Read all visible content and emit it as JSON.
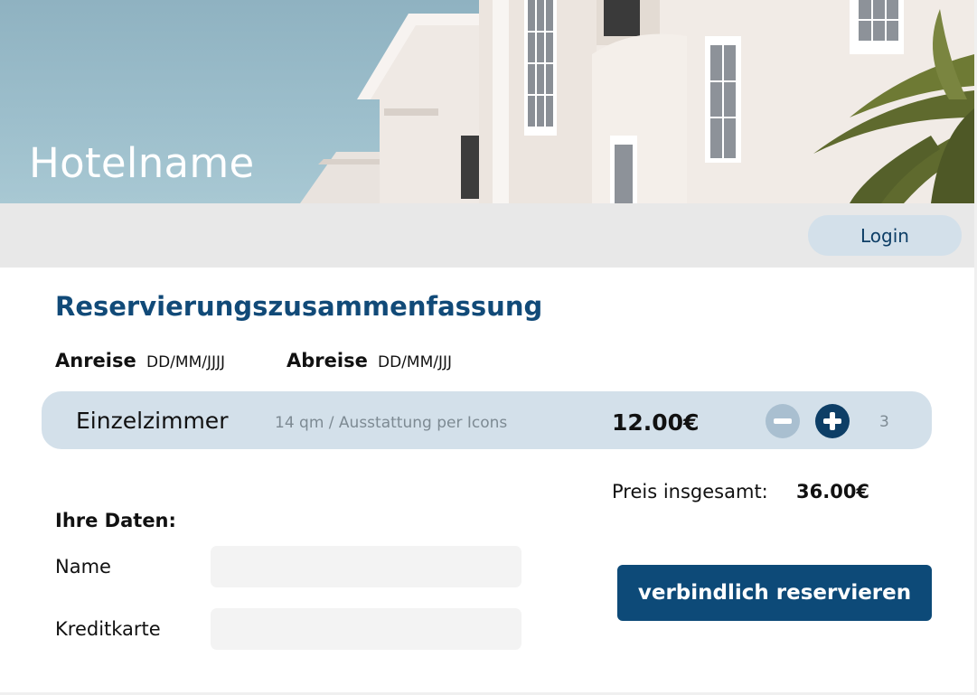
{
  "header": {
    "hotel_name": "Hotelname",
    "login_label": "Login"
  },
  "summary": {
    "title": "Reservierungszusammenfassung",
    "arrival_label": "Anreise",
    "arrival_value": "DD/MM/JJJJ",
    "departure_label": "Abreise",
    "departure_value": "DD/MM/JJJ"
  },
  "room": {
    "name": "Einzelzimmer",
    "description": "14 qm / Ausstattung per Icons",
    "price": "12.00€",
    "quantity": "3",
    "minus_icon": "minus-circle-icon",
    "plus_icon": "plus-circle-icon"
  },
  "total": {
    "label": "Preis insgesamt:",
    "value": "36.00€"
  },
  "form": {
    "section_label": "Ihre Daten:",
    "name_label": "Name",
    "name_value": "",
    "card_label": "Kreditkarte",
    "card_value": ""
  },
  "actions": {
    "reserve_label": "verbindlich reservieren"
  },
  "colors": {
    "primary": "#0d4a78",
    "title": "#114a78",
    "room_bg": "#d3e0ea",
    "bar_bg": "#e8e8e8",
    "sky": "#9dbfcc"
  }
}
